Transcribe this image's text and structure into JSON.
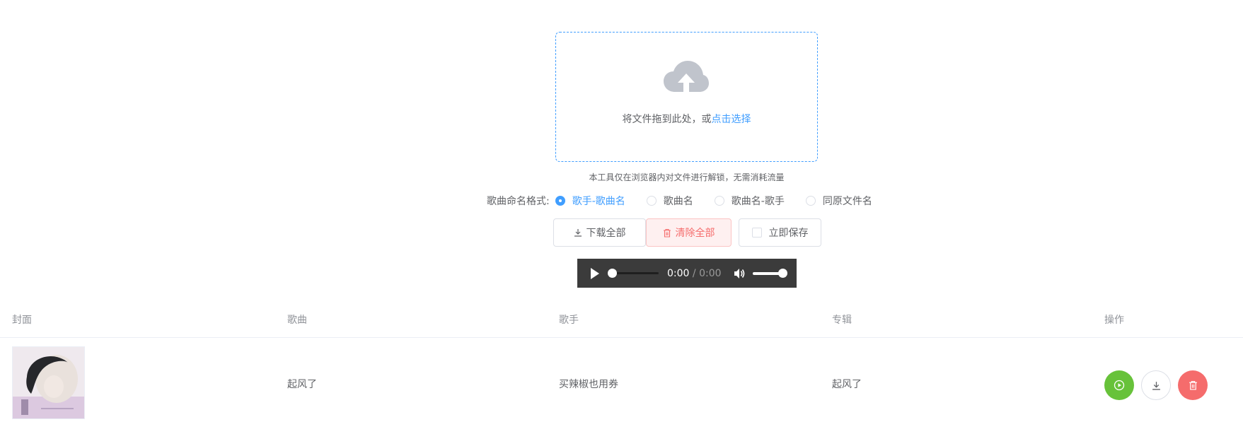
{
  "upload": {
    "drop_text": "将文件拖到此处，或",
    "select_link": "点击选择",
    "tip": "本工具仅在浏览器内对文件进行解锁，无需消耗流量"
  },
  "naming": {
    "label": "歌曲命名格式:",
    "options": [
      "歌手-歌曲名",
      "歌曲名",
      "歌曲名-歌手",
      "同原文件名"
    ],
    "selected": "歌手-歌曲名"
  },
  "actions": {
    "download_all": "下载全部",
    "clear_all": "清除全部",
    "save_now": "立即保存"
  },
  "player": {
    "current_time": "0:00",
    "separator": " / ",
    "duration": "0:00",
    "progress": 0,
    "volume": 1
  },
  "table": {
    "headers": [
      "封面",
      "歌曲",
      "歌手",
      "专辑",
      "操作"
    ],
    "rows": [
      {
        "title": "起风了",
        "artist": "买辣椒也用券",
        "album": "起风了"
      }
    ]
  },
  "colors": {
    "primary": "#409eff",
    "success": "#67c23a",
    "danger": "#f56c6c",
    "player_bg": "#3b3b3b"
  },
  "icons": {
    "upload": "cloud-upload-icon",
    "download": "download-icon",
    "delete": "trash-icon",
    "play": "play-icon",
    "volume": "volume-icon"
  }
}
